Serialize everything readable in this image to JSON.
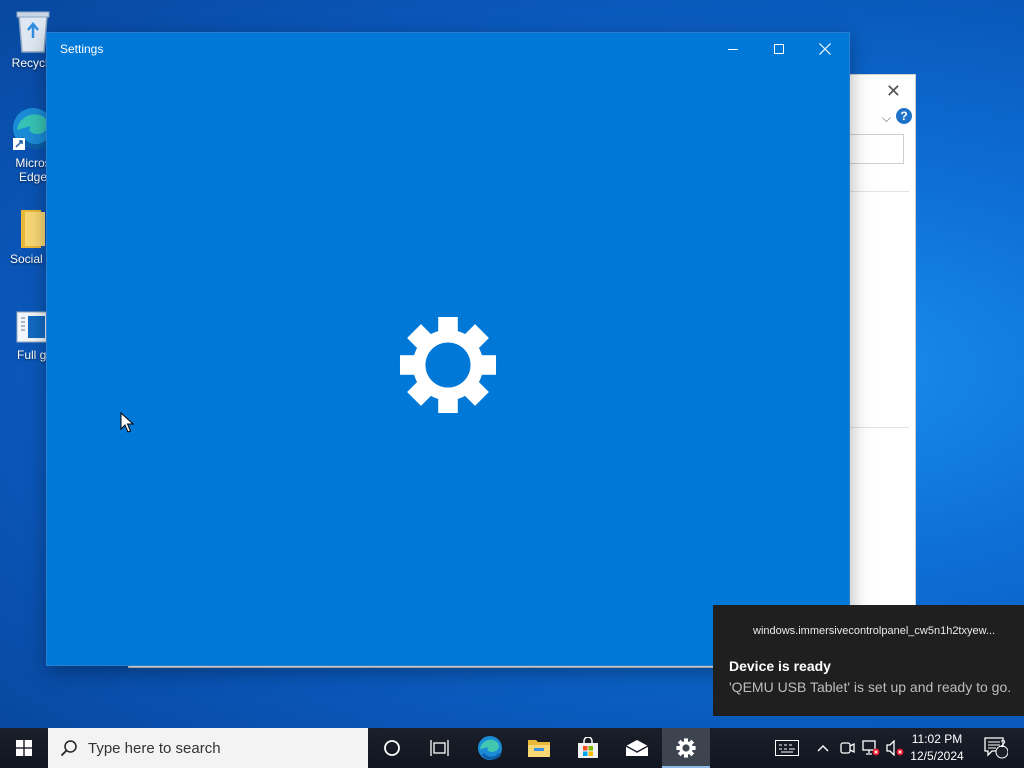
{
  "desktop": {
    "icons": [
      {
        "label": "Recycle",
        "icon": "recycle-bin-icon"
      },
      {
        "label": "Micros Edge",
        "icon": "edge-icon"
      },
      {
        "label": "Social M",
        "icon": "folder-icon"
      },
      {
        "label": "Full gl",
        "icon": "app-shortcut-icon"
      }
    ]
  },
  "settings_window": {
    "title": "Settings",
    "controls": {
      "minimize": "minimize-icon",
      "maximize": "maximize-icon",
      "close": "close-icon"
    },
    "splash_icon": "gear-icon",
    "background": "#0078d7"
  },
  "notification": {
    "app": "windows.immersivecontrolpanel_cw5n1h2txyew...",
    "title": "Device is ready",
    "body": "'QEMU USB Tablet' is set up and ready to go."
  },
  "taskbar": {
    "search_placeholder": "Type here to search",
    "pinned": [
      "cortana-icon",
      "task-view-icon",
      "edge-icon",
      "file-explorer-icon",
      "store-icon",
      "mail-icon",
      "settings-icon"
    ],
    "active": "settings-icon",
    "tray": [
      "input-indicator-icon",
      "chevron-up-icon",
      "meet-now-icon",
      "network-icon",
      "volume-muted-icon"
    ],
    "time": "11:02 PM",
    "date": "12/5/2024",
    "notification_count": "2"
  }
}
